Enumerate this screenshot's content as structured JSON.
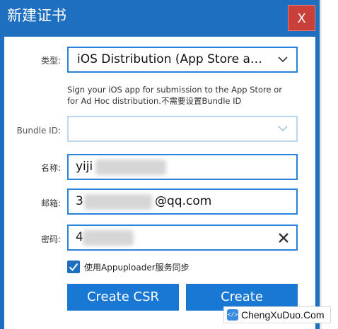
{
  "window": {
    "title": "新建证书",
    "close_label": "X"
  },
  "form": {
    "type": {
      "label": "类型:",
      "selected": "iOS Distribution (App Store and Ad Hoc)"
    },
    "hint": "Sign your iOS app for submission to the App Store or for Ad Hoc distribution.不需要设置Bundle ID",
    "bundle_id": {
      "label": "Bundle ID:",
      "value": ""
    },
    "name": {
      "label": "名称:",
      "value": "yiji"
    },
    "email": {
      "label": "邮箱:",
      "value_prefix": "3",
      "value_suffix": "@qq.com"
    },
    "password": {
      "label": "密码:",
      "value": "4"
    },
    "sync": {
      "checked": true,
      "label": "使用Appuploader服务同步"
    }
  },
  "buttons": {
    "create_csr": "Create CSR",
    "create": "Create"
  },
  "watermark": {
    "icon_glyph": "</>",
    "text": "ChengXuDuo.Com"
  },
  "colors": {
    "window_blue": "#1f6fc1",
    "button_blue": "#1878d3",
    "close_red": "#c9403a",
    "field_border": "#2a82da"
  }
}
